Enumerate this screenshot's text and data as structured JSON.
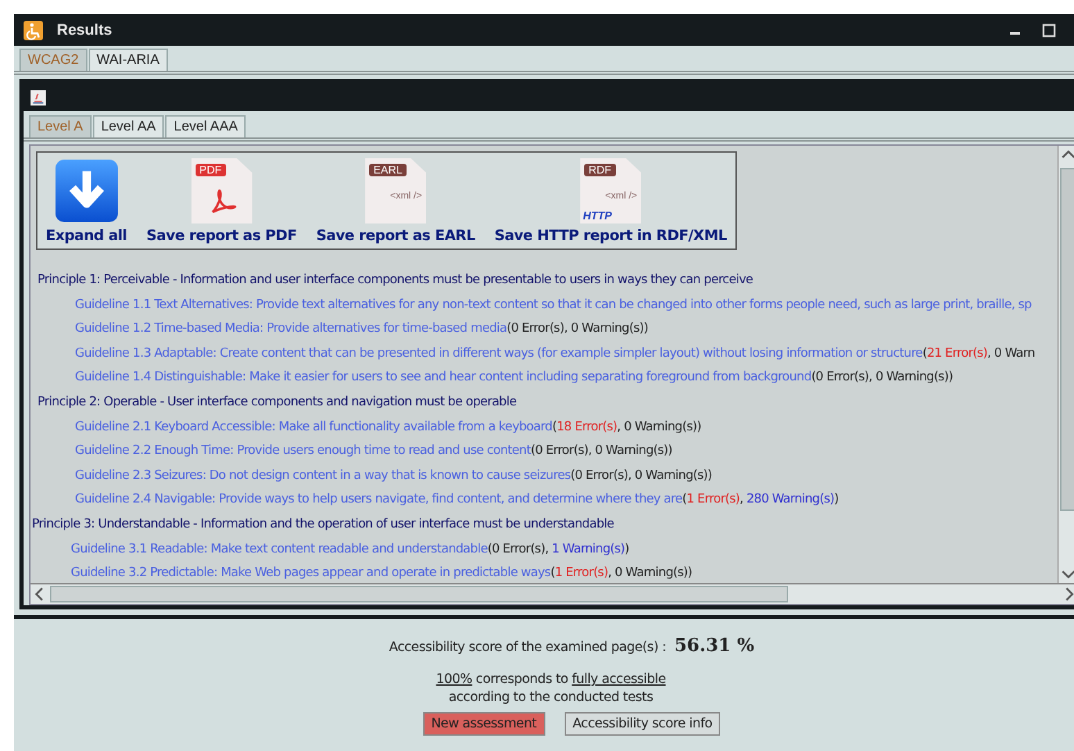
{
  "window": {
    "title": "Results"
  },
  "tabs": [
    {
      "label": "WCAG2",
      "selected": true
    },
    {
      "label": "WAI-ARIA",
      "selected": false
    }
  ],
  "level_tabs": [
    {
      "label": "Level A",
      "selected": true
    },
    {
      "label": "Level AA",
      "selected": false
    },
    {
      "label": "Level AAA",
      "selected": false
    }
  ],
  "toolbar": [
    {
      "kind": "expand",
      "label": "Expand all"
    },
    {
      "kind": "pdf",
      "label": "Save report as PDF",
      "tag": "PDF"
    },
    {
      "kind": "earl",
      "label": "Save report as EARL",
      "tag": "EARL",
      "code": "<xml />"
    },
    {
      "kind": "rdf",
      "label": "Save HTTP report in RDF/XML",
      "tag": "RDF",
      "code": "<xml />",
      "protocol": "HTTP"
    }
  ],
  "tree": [
    {
      "title": "Principle 1: Perceivable - Information and user interface components must be presentable to users in ways they can perceive",
      "children": [
        {
          "title": "Guideline 1.1 Text Alternatives: Provide text alternatives for any non-text content so that it can be changed into other forms people need, such as large print, braille, sp"
        },
        {
          "title": "Guideline 1.2 Time-based Media: Provide alternatives for time-based media",
          "result": [
            {
              "text": "(0 Error(s), 0 Warning(s))",
              "kind": "plain"
            }
          ]
        },
        {
          "title": "Guideline 1.3 Adaptable: Create content that can be presented in different ways (for example simpler layout) without losing information or structure",
          "result": [
            {
              "text": "(",
              "kind": "plain"
            },
            {
              "text": "21 Error(s)",
              "kind": "error"
            },
            {
              "text": ", 0 Warn",
              "kind": "plain"
            }
          ]
        },
        {
          "title": "Guideline 1.4 Distinguishable: Make it easier for users to see and hear content including separating foreground from background",
          "result": [
            {
              "text": "(0 Error(s), 0 Warning(s))",
              "kind": "plain"
            }
          ]
        }
      ]
    },
    {
      "title": "Principle 2: Operable - User interface components and navigation must be operable",
      "children": [
        {
          "title": "Guideline 2.1 Keyboard Accessible: Make all functionality available from a keyboard",
          "result": [
            {
              "text": "(",
              "kind": "plain"
            },
            {
              "text": "18 Error(s)",
              "kind": "error"
            },
            {
              "text": ", 0 Warning(s))",
              "kind": "plain"
            }
          ]
        },
        {
          "title": "Guideline 2.2 Enough Time: Provide users enough time to read and use content",
          "result": [
            {
              "text": "(0 Error(s), 0 Warning(s))",
              "kind": "plain"
            }
          ]
        },
        {
          "title": "Guideline 2.3 Seizures: Do not design content in a way that is known to cause seizures",
          "result": [
            {
              "text": "(0 Error(s), 0 Warning(s))",
              "kind": "plain"
            }
          ]
        },
        {
          "title": "Guideline 2.4 Navigable: Provide ways to help users navigate, find content, and determine where they are",
          "result": [
            {
              "text": "(",
              "kind": "plain"
            },
            {
              "text": "1 Error(s)",
              "kind": "error"
            },
            {
              "text": ", ",
              "kind": "plain"
            },
            {
              "text": "280 Warning(s)",
              "kind": "warning"
            },
            {
              "text": ")",
              "kind": "plain"
            }
          ]
        }
      ]
    },
    {
      "title": "Principle 3: Understandable - Information and the operation of user interface must be understandable",
      "children": [
        {
          "title": "Guideline 3.1 Readable: Make text content readable and understandable",
          "result": [
            {
              "text": "(0 Error(s), ",
              "kind": "plain"
            },
            {
              "text": "1 Warning(s)",
              "kind": "warning"
            },
            {
              "text": ")",
              "kind": "plain"
            }
          ]
        },
        {
          "title": "Guideline 3.2 Predictable: Make Web pages appear and operate in predictable ways",
          "result": [
            {
              "text": "(",
              "kind": "plain"
            },
            {
              "text": "1 Error(s)",
              "kind": "error"
            },
            {
              "text": ", 0 Warning(s))",
              "kind": "plain"
            }
          ]
        }
      ]
    }
  ],
  "score": {
    "label": "Accessibility score of the examined page(s) :",
    "value": "56.31 %",
    "note_link_1": "100%",
    "note_text": "corresponds to",
    "note_link_2": "fully accessible",
    "note_line_2": "according to the conducted tests"
  },
  "buttons": [
    {
      "label": "New assessment",
      "kind": "danger"
    },
    {
      "label": "Accessibility score info",
      "kind": "default"
    }
  ]
}
